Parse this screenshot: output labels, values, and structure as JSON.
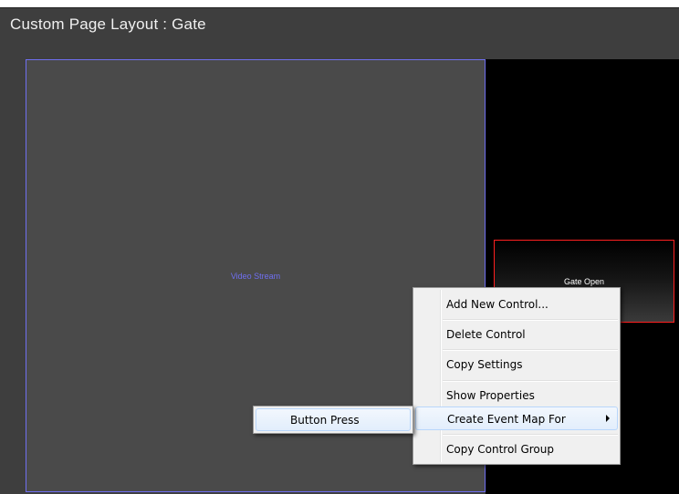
{
  "page": {
    "title": "Custom Page Layout : Gate"
  },
  "controls": {
    "video_stream_label": "Video Stream",
    "gate_button_label": "Gate Open"
  },
  "context_menu": {
    "items": [
      {
        "label": "Add New Control..."
      },
      {
        "label": "Delete Control"
      },
      {
        "label": "Copy Settings"
      },
      {
        "label": "Show Properties"
      },
      {
        "label": "Create Event Map For",
        "has_submenu": true,
        "highlighted": true
      },
      {
        "label": "Copy Control Group"
      }
    ]
  },
  "submenu": {
    "items": [
      {
        "label": "Button Press",
        "highlighted": true
      }
    ]
  },
  "colors": {
    "video_border": "#6f6ff0",
    "gate_border": "#ff2020",
    "menu_highlight": "#b8d6fb"
  }
}
